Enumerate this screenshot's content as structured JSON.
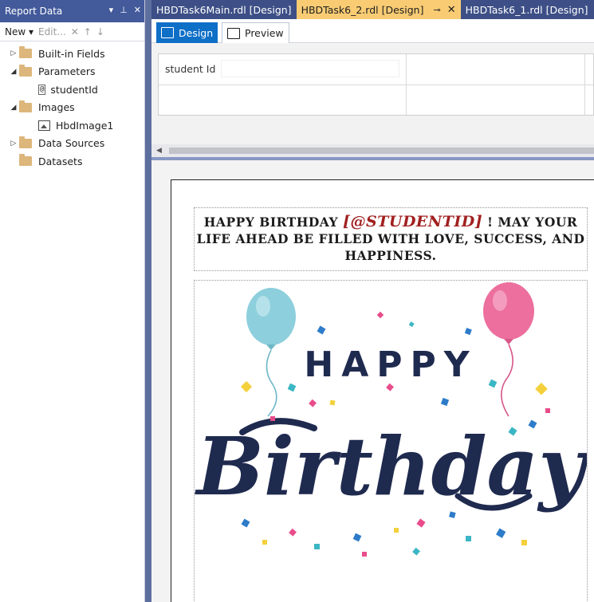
{
  "report_panel": {
    "title": "Report Data",
    "toolbar": {
      "new_label": "New",
      "edit_label": "Edit..."
    },
    "tree": {
      "built_in_fields": "Built-in Fields",
      "parameters": "Parameters",
      "parameter_item": "studentId",
      "images": "Images",
      "image_item": "HbdImage1",
      "data_sources": "Data Sources",
      "datasets": "Datasets"
    }
  },
  "doc_tabs": [
    {
      "label": "HBDTask6Main.rdl [Design]"
    },
    {
      "label": "HBDTask6_2.rdl [Design]"
    },
    {
      "label": "HBDTask6_1.rdl [Design]"
    }
  ],
  "view_tabs": {
    "design": "Design",
    "preview": "Preview"
  },
  "parameters_pane": {
    "student_id_label": "student Id",
    "student_id_value": ""
  },
  "report": {
    "message_before": "Happy Birthday ",
    "message_param": "[@STUDENTID]",
    "message_line1_end": " ! May your",
    "message_line2": "life ahead be filled with love, success, and",
    "message_line3": "happiness.",
    "image_text_happy": "HAPPY",
    "image_text_birthday": "Birthday"
  },
  "colors": {
    "panel_header": "#435a9b",
    "active_tab": "#f9cc74",
    "design_tab": "#0e6fc7",
    "param_red": "#a11f1f",
    "balloon_blue": "#8dcfdc",
    "balloon_pink": "#ec6f9e",
    "birthday_navy": "#1f2a4f"
  }
}
